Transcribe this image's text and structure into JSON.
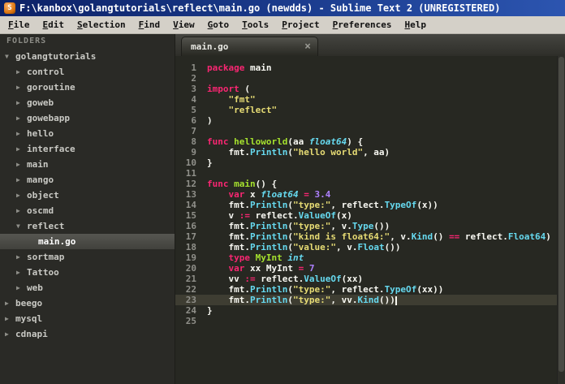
{
  "window": {
    "title": "F:\\kanbox\\golangtutorials\\reflect\\main.go (newdds) - Sublime Text 2 (UNREGISTERED)"
  },
  "icons": {
    "app_glyph": "S",
    "folder_expanded": "▼",
    "folder_collapsed": "▶",
    "tab_close": "×"
  },
  "menu": {
    "items": [
      "File",
      "Edit",
      "Selection",
      "Find",
      "View",
      "Goto",
      "Tools",
      "Project",
      "Preferences",
      "Help"
    ]
  },
  "sidebar": {
    "header": "FOLDERS",
    "items": [
      {
        "label": "golangtutorials",
        "level": 0,
        "type": "folder",
        "state": "expanded"
      },
      {
        "label": "control",
        "level": 1,
        "type": "folder",
        "state": "collapsed"
      },
      {
        "label": "goroutine",
        "level": 1,
        "type": "folder",
        "state": "collapsed"
      },
      {
        "label": "goweb",
        "level": 1,
        "type": "folder",
        "state": "collapsed"
      },
      {
        "label": "gowebapp",
        "level": 1,
        "type": "folder",
        "state": "collapsed"
      },
      {
        "label": "hello",
        "level": 1,
        "type": "folder",
        "state": "collapsed"
      },
      {
        "label": "interface",
        "level": 1,
        "type": "folder",
        "state": "collapsed"
      },
      {
        "label": "main",
        "level": 1,
        "type": "folder",
        "state": "collapsed"
      },
      {
        "label": "mango",
        "level": 1,
        "type": "folder",
        "state": "collapsed"
      },
      {
        "label": "object",
        "level": 1,
        "type": "folder",
        "state": "collapsed"
      },
      {
        "label": "oscmd",
        "level": 1,
        "type": "folder",
        "state": "collapsed"
      },
      {
        "label": "reflect",
        "level": 1,
        "type": "folder",
        "state": "expanded"
      },
      {
        "label": "main.go",
        "level": 2,
        "type": "file",
        "selected": true
      },
      {
        "label": "sortmap",
        "level": 1,
        "type": "folder",
        "state": "collapsed"
      },
      {
        "label": "Tattoo",
        "level": 1,
        "type": "folder",
        "state": "collapsed"
      },
      {
        "label": "web",
        "level": 1,
        "type": "folder",
        "state": "collapsed"
      },
      {
        "label": "beego",
        "level": 0,
        "type": "folder",
        "state": "collapsed"
      },
      {
        "label": "mysql",
        "level": 0,
        "type": "folder",
        "state": "collapsed"
      },
      {
        "label": "cdnapi",
        "level": 0,
        "type": "folder",
        "state": "collapsed"
      }
    ]
  },
  "editor": {
    "tab": {
      "label": "main.go"
    },
    "current_line": 23,
    "lines": [
      {
        "n": 1,
        "s": [
          [
            "package",
            "k"
          ],
          [
            " main",
            "p"
          ]
        ]
      },
      {
        "n": 2,
        "s": []
      },
      {
        "n": 3,
        "s": [
          [
            "import",
            "k"
          ],
          [
            " (",
            "p"
          ]
        ]
      },
      {
        "n": 4,
        "s": [
          [
            "    ",
            "p"
          ],
          [
            "\"fmt\"",
            "s"
          ]
        ]
      },
      {
        "n": 5,
        "s": [
          [
            "    ",
            "p"
          ],
          [
            "\"reflect\"",
            "s"
          ]
        ]
      },
      {
        "n": 6,
        "s": [
          [
            ")",
            "p"
          ]
        ]
      },
      {
        "n": 7,
        "s": []
      },
      {
        "n": 8,
        "s": [
          [
            "func",
            "k"
          ],
          [
            " ",
            "p"
          ],
          [
            "helloworld",
            "f"
          ],
          [
            "(aa ",
            "p"
          ],
          [
            "float64",
            "t"
          ],
          [
            ") {",
            "p"
          ]
        ]
      },
      {
        "n": 9,
        "s": [
          [
            "    fmt.",
            "p"
          ],
          [
            "Println",
            "c"
          ],
          [
            "(",
            "p"
          ],
          [
            "\"hello world\"",
            "s"
          ],
          [
            ", aa)",
            "p"
          ]
        ]
      },
      {
        "n": 10,
        "s": [
          [
            "}",
            "p"
          ]
        ]
      },
      {
        "n": 11,
        "s": []
      },
      {
        "n": 12,
        "s": [
          [
            "func",
            "k"
          ],
          [
            " ",
            "p"
          ],
          [
            "main",
            "f"
          ],
          [
            "() {",
            "p"
          ]
        ]
      },
      {
        "n": 13,
        "s": [
          [
            "    ",
            "p"
          ],
          [
            "var",
            "k"
          ],
          [
            " x ",
            "p"
          ],
          [
            "float64",
            "t"
          ],
          [
            " ",
            "p"
          ],
          [
            "=",
            "o"
          ],
          [
            " ",
            "p"
          ],
          [
            "3.4",
            "n"
          ]
        ]
      },
      {
        "n": 14,
        "s": [
          [
            "    fmt.",
            "p"
          ],
          [
            "Println",
            "c"
          ],
          [
            "(",
            "p"
          ],
          [
            "\"type:\"",
            "s"
          ],
          [
            ", reflect.",
            "p"
          ],
          [
            "TypeOf",
            "c"
          ],
          [
            "(x))",
            "p"
          ]
        ]
      },
      {
        "n": 15,
        "s": [
          [
            "    v ",
            "p"
          ],
          [
            ":=",
            "o"
          ],
          [
            " reflect.",
            "p"
          ],
          [
            "ValueOf",
            "c"
          ],
          [
            "(x)",
            "p"
          ]
        ]
      },
      {
        "n": 16,
        "s": [
          [
            "    fmt.",
            "p"
          ],
          [
            "Println",
            "c"
          ],
          [
            "(",
            "p"
          ],
          [
            "\"type:\"",
            "s"
          ],
          [
            ", v.",
            "p"
          ],
          [
            "Type",
            "c"
          ],
          [
            "())",
            "p"
          ]
        ]
      },
      {
        "n": 17,
        "s": [
          [
            "    fmt.",
            "p"
          ],
          [
            "Println",
            "c"
          ],
          [
            "(",
            "p"
          ],
          [
            "\"kind is float64:\"",
            "s"
          ],
          [
            ", v.",
            "p"
          ],
          [
            "Kind",
            "c"
          ],
          [
            "() ",
            "p"
          ],
          [
            "==",
            "o"
          ],
          [
            " reflect.",
            "p"
          ],
          [
            "Float64",
            "c"
          ],
          [
            ")",
            "p"
          ]
        ]
      },
      {
        "n": 18,
        "s": [
          [
            "    fmt.",
            "p"
          ],
          [
            "Println",
            "c"
          ],
          [
            "(",
            "p"
          ],
          [
            "\"value:\"",
            "s"
          ],
          [
            ", v.",
            "p"
          ],
          [
            "Float",
            "c"
          ],
          [
            "())",
            "p"
          ]
        ]
      },
      {
        "n": 19,
        "s": [
          [
            "    ",
            "p"
          ],
          [
            "type",
            "k"
          ],
          [
            " ",
            "p"
          ],
          [
            "MyInt",
            "f"
          ],
          [
            " ",
            "p"
          ],
          [
            "int",
            "t"
          ]
        ]
      },
      {
        "n": 20,
        "s": [
          [
            "    ",
            "p"
          ],
          [
            "var",
            "k"
          ],
          [
            " xx MyInt ",
            "p"
          ],
          [
            "=",
            "o"
          ],
          [
            " ",
            "p"
          ],
          [
            "7",
            "n"
          ]
        ]
      },
      {
        "n": 21,
        "s": [
          [
            "    vv ",
            "p"
          ],
          [
            ":=",
            "o"
          ],
          [
            " reflect.",
            "p"
          ],
          [
            "ValueOf",
            "c"
          ],
          [
            "(xx)",
            "p"
          ]
        ]
      },
      {
        "n": 22,
        "s": [
          [
            "    fmt.",
            "p"
          ],
          [
            "Println",
            "c"
          ],
          [
            "(",
            "p"
          ],
          [
            "\"type:\"",
            "s"
          ],
          [
            ", reflect.",
            "p"
          ],
          [
            "TypeOf",
            "c"
          ],
          [
            "(xx))",
            "p"
          ]
        ]
      },
      {
        "n": 23,
        "s": [
          [
            "    fmt.",
            "p"
          ],
          [
            "Println",
            "c"
          ],
          [
            "(",
            "p"
          ],
          [
            "\"type:\"",
            "s"
          ],
          [
            ", vv.",
            "p"
          ],
          [
            "Kind",
            "c"
          ],
          [
            "())",
            "p"
          ]
        ]
      },
      {
        "n": 24,
        "s": [
          [
            "}",
            "p"
          ]
        ]
      },
      {
        "n": 25,
        "s": []
      }
    ]
  },
  "colors": {
    "keyword": "#f92672",
    "string": "#e6db74",
    "funcname": "#a6e22e",
    "typename": "#66d9ef",
    "call": "#66d9ef",
    "number": "#ae81ff",
    "text": "#f8f8f2",
    "editor-bg": "#272822",
    "gutter": "#90908a",
    "current-line": "#3e3d32"
  }
}
